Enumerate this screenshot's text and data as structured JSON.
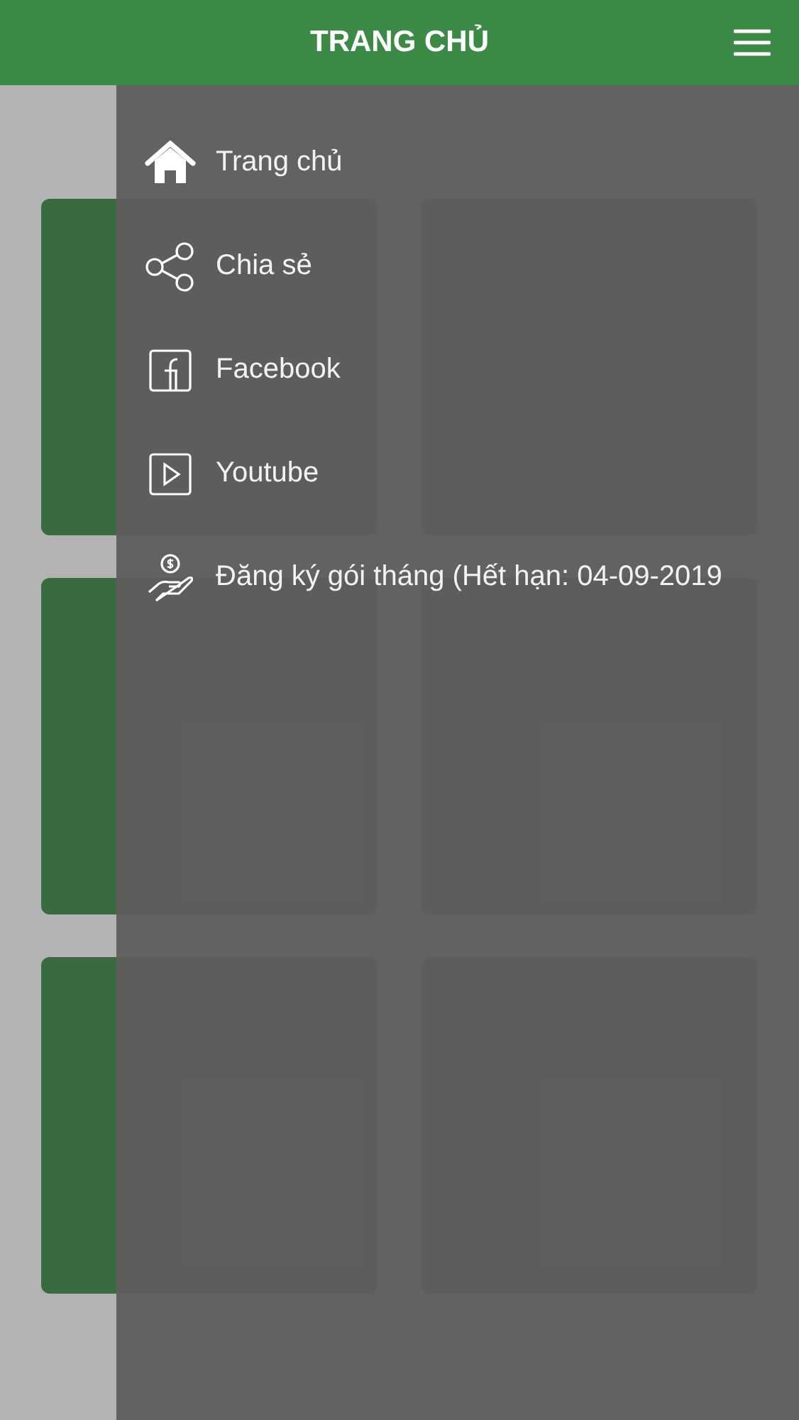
{
  "header": {
    "title": "TRANG CHỦ"
  },
  "drawer": {
    "items": [
      {
        "kind": "home",
        "label": "Trang chủ"
      },
      {
        "kind": "share",
        "label": "Chia sẻ"
      },
      {
        "kind": "facebook",
        "label": "Facebook"
      },
      {
        "kind": "youtube",
        "label": "Youtube"
      },
      {
        "kind": "subscription",
        "label": "Đăng ký gói tháng (Hết hạn: 04-09-2019"
      }
    ]
  }
}
